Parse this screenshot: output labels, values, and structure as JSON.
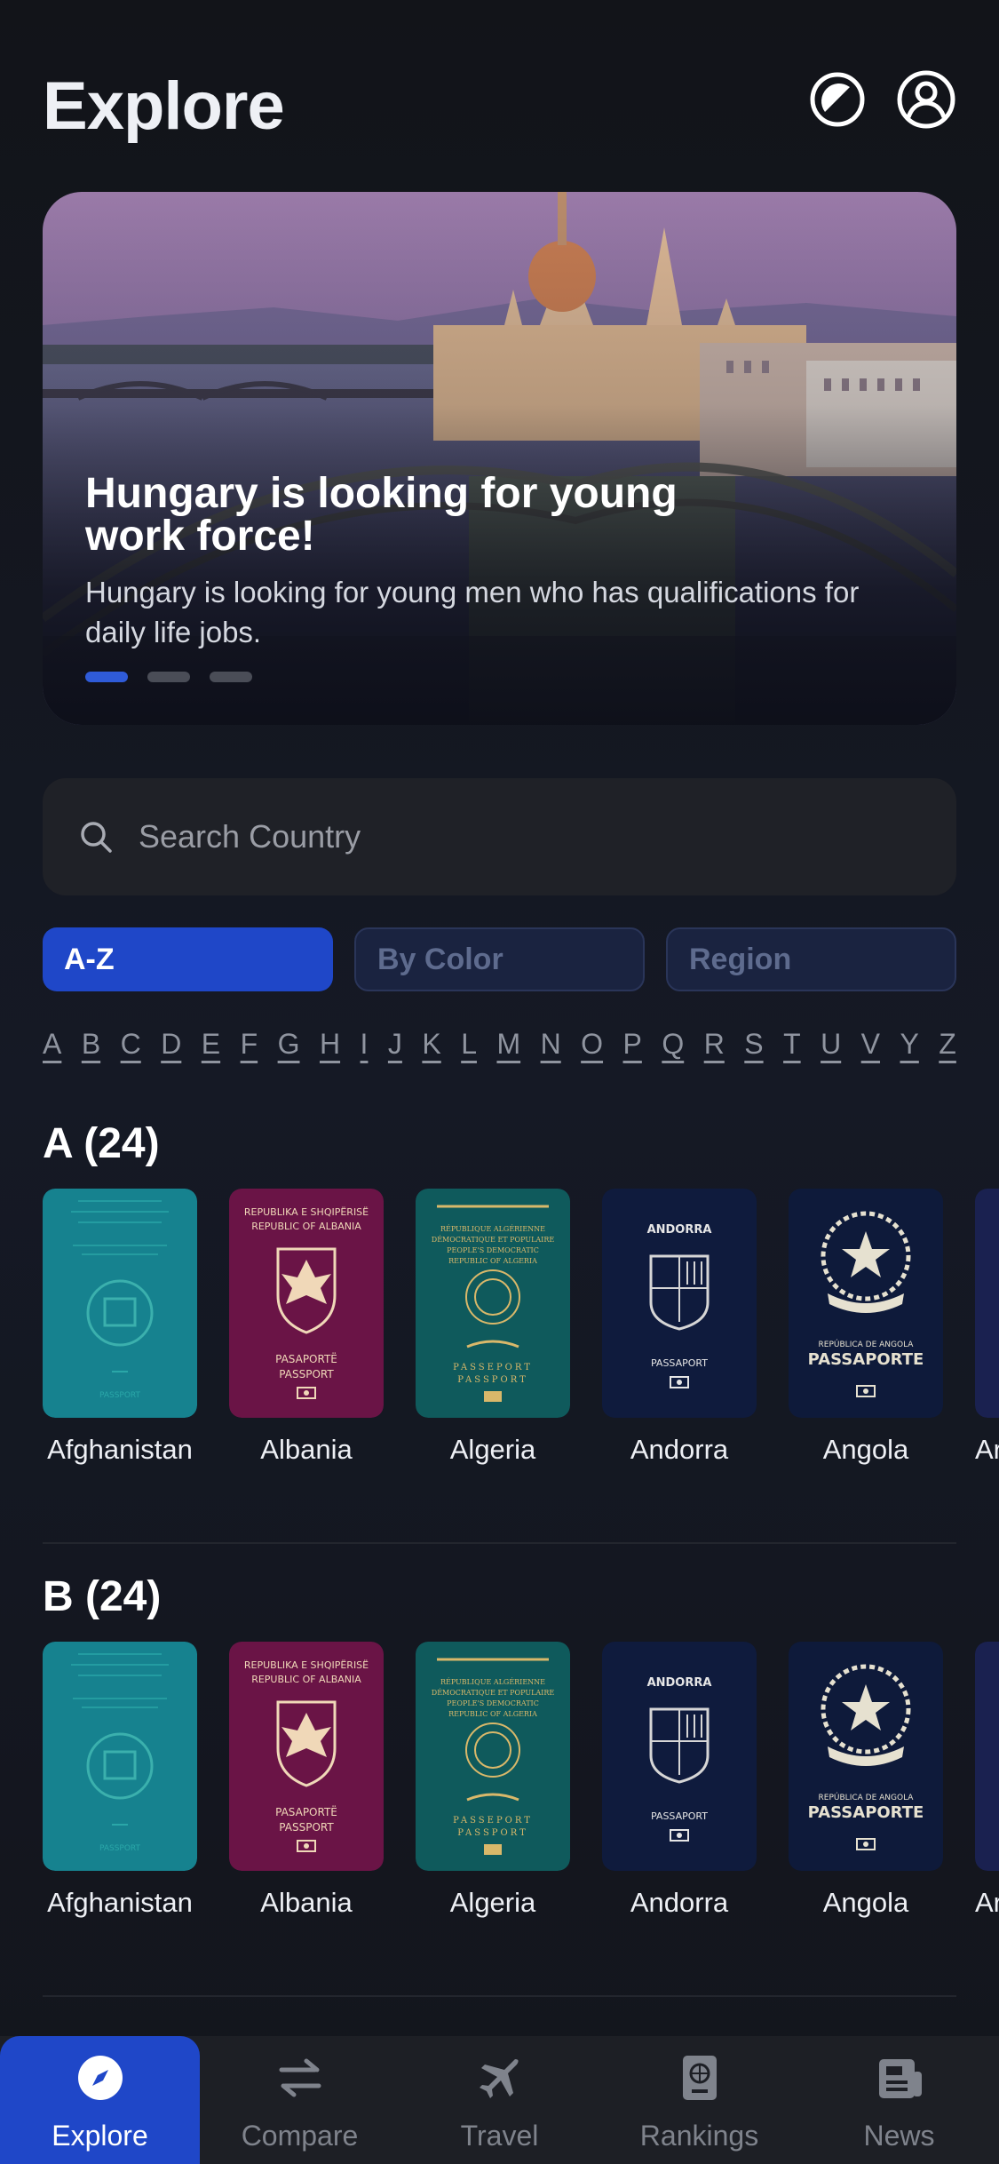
{
  "header": {
    "title": "Explore",
    "theme_icon": "contrast-icon",
    "profile_icon": "user-circle-icon"
  },
  "banner": {
    "title": "Hungary is looking for young work force!",
    "subtitle": "Hungary is looking for young men who has qualifications for daily life jobs.",
    "pager_total": 3,
    "pager_active": 1
  },
  "search": {
    "placeholder": "Search Country",
    "icon": "search-icon"
  },
  "filters": {
    "tabs": [
      {
        "label": "A-Z",
        "active": true
      },
      {
        "label": "By Color",
        "active": false
      },
      {
        "label": "Region",
        "active": false
      }
    ]
  },
  "alphabet": [
    "A",
    "B",
    "C",
    "D",
    "E",
    "F",
    "G",
    "H",
    "I",
    "J",
    "K",
    "L",
    "M",
    "N",
    "O",
    "P",
    "Q",
    "R",
    "S",
    "T",
    "U",
    "V",
    "Y",
    "Z"
  ],
  "sections": [
    {
      "title": "A (24)",
      "items": [
        {
          "name": "Afghanistan"
        },
        {
          "name": "Albania"
        },
        {
          "name": "Algeria"
        },
        {
          "name": "Andorra"
        },
        {
          "name": "Angola"
        },
        {
          "name": "Ar"
        }
      ]
    },
    {
      "title": "B (24)",
      "items": [
        {
          "name": "Afghanistan"
        },
        {
          "name": "Albania"
        },
        {
          "name": "Algeria"
        },
        {
          "name": "Andorra"
        },
        {
          "name": "Angola"
        },
        {
          "name": "Ar"
        }
      ]
    }
  ],
  "passport_text": {
    "albania_top": "REPUBLIKA E SHQIPËRISË",
    "albania_top2": "REPUBLIC OF ALBANIA",
    "albania_bottom": "PASAPORTË",
    "albania_bottom2": "PASSPORT",
    "algeria_top": "RÉPUBLIQUE ALGÉRIENNE",
    "algeria_top2": "DÉMOCRATIQUE ET POPULAIRE",
    "algeria_top3": "PEOPLE'S DEMOCRATIC",
    "algeria_top4": "REPUBLIC OF ALGERIA",
    "algeria_bottom": "PASSEPORT",
    "algeria_bottom2": "PASSPORT",
    "andorra_top": "ANDORRA",
    "andorra_bottom": "PASSAPORT",
    "angola_top": "REPÚBLICA DE ANGOLA",
    "angola_bottom": "PASSAPORTE",
    "afghanistan_bottom": "PASSPORT"
  },
  "colors": {
    "accent": "#1f47c8",
    "afghanistan": "#16828f",
    "albania": "#6a1446",
    "algeria": "#0f5a5c",
    "andorra": "#0f1b3d",
    "angola": "#0e1a3a"
  },
  "nav": {
    "items": [
      {
        "label": "Explore",
        "icon": "compass-icon",
        "active": true
      },
      {
        "label": "Compare",
        "icon": "swap-arrows-icon",
        "active": false
      },
      {
        "label": "Travel",
        "icon": "airplane-icon",
        "active": false
      },
      {
        "label": "Rankings",
        "icon": "passport-globe-icon",
        "active": false
      },
      {
        "label": "News",
        "icon": "newspaper-icon",
        "active": false
      }
    ]
  }
}
